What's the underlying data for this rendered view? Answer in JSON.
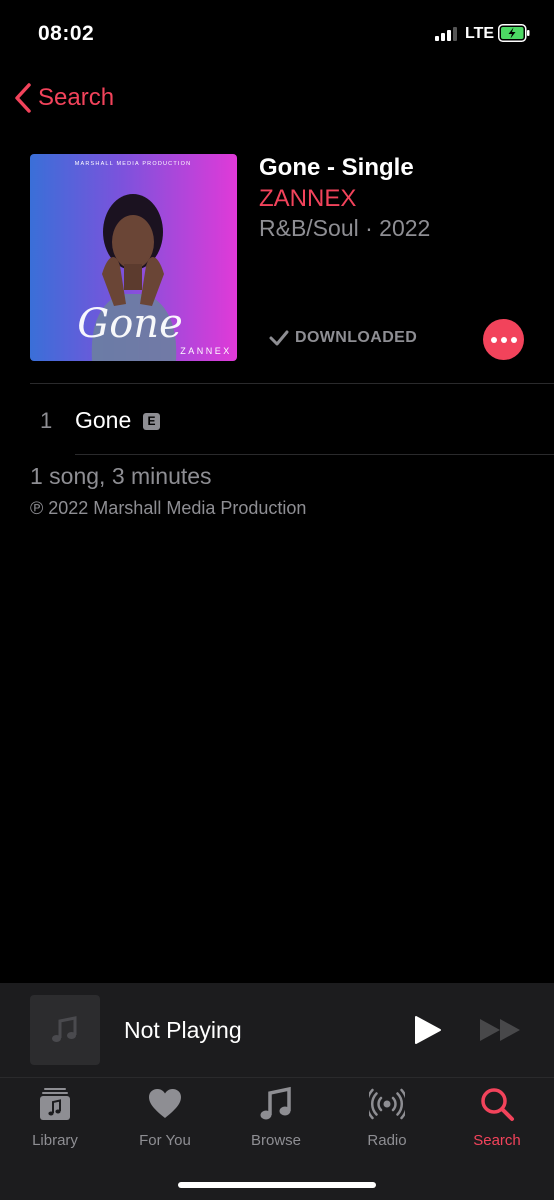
{
  "status_bar": {
    "time": "08:02",
    "network": "LTE",
    "signal_bars": 3,
    "battery_icon": "battery-charging-icon"
  },
  "nav": {
    "back_label": "Search",
    "back_icon": "chevron-left-icon"
  },
  "album": {
    "title": "Gone - Single",
    "artist": "ZANNEX",
    "meta": "R&B/Soul · 2022",
    "artwork": {
      "header": "MARSHALL MEDIA PRODUCTION",
      "script_title": "Gone",
      "artist_mark": "ZANNEX"
    },
    "download_status": "DOWNLOADED",
    "more_icon": "ellipsis-icon"
  },
  "tracks": [
    {
      "number": "1",
      "title": "Gone",
      "explicit_badge": "E"
    }
  ],
  "summary": {
    "song_count": "1 song, 3 minutes",
    "copyright": "℗ 2022 Marshall Media Production"
  },
  "mini_player": {
    "title": "Not Playing",
    "play_icon": "play-icon",
    "forward_icon": "fast-forward-icon"
  },
  "tab_bar": {
    "tabs": [
      {
        "label": "Library",
        "icon": "library-icon",
        "active": false
      },
      {
        "label": "For You",
        "icon": "heart-icon",
        "active": false
      },
      {
        "label": "Browse",
        "icon": "music-note-icon",
        "active": false
      },
      {
        "label": "Radio",
        "icon": "radio-icon",
        "active": false
      },
      {
        "label": "Search",
        "icon": "search-icon",
        "active": true
      }
    ]
  },
  "colors": {
    "accent": "#f2435b",
    "secondary_text": "#8e8e93",
    "background": "#000000",
    "bar_background": "#1c1c1e",
    "battery_green": "#4cd964"
  }
}
